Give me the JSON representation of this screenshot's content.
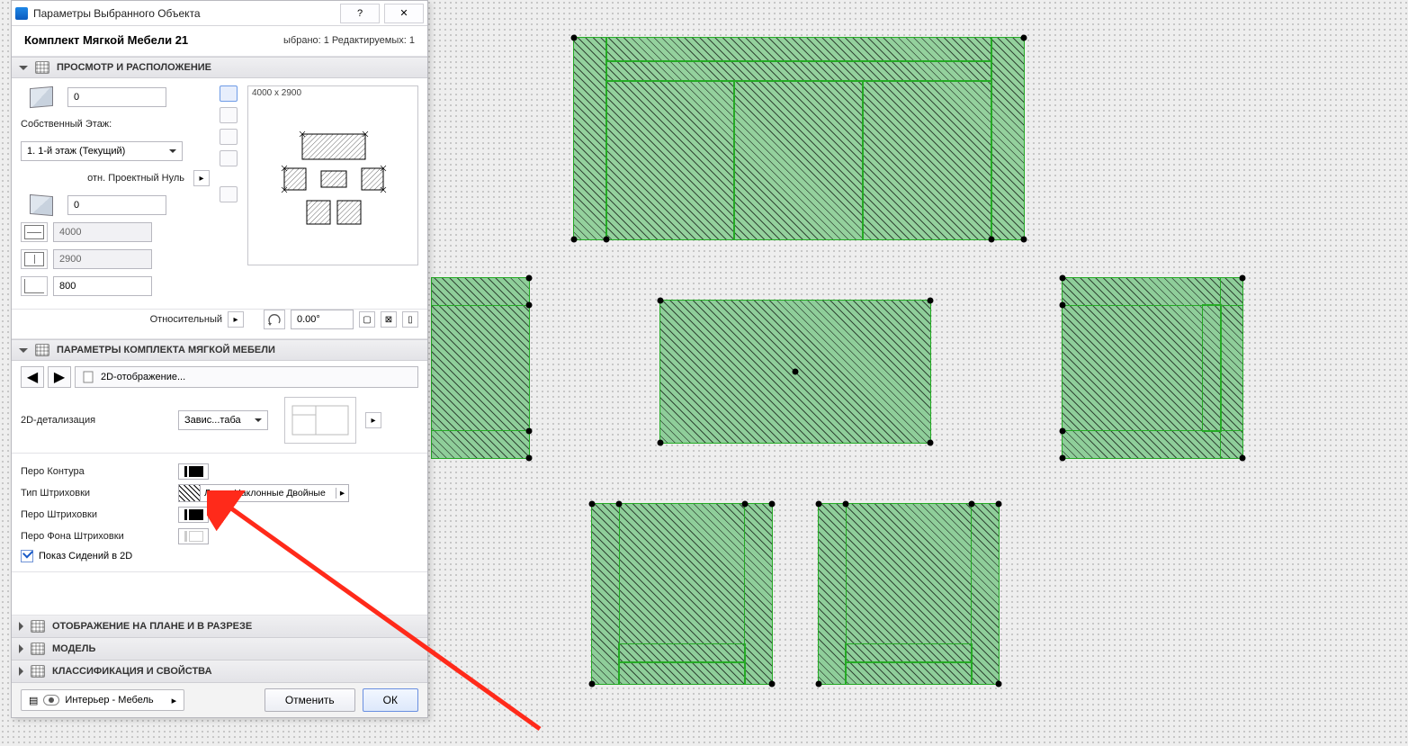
{
  "dialog": {
    "title": "Параметры Выбранного Объекта",
    "object_name": "Комплект Мягкой Мебели 21",
    "selection_info": "ыбрано: 1 Редактируемых: 1"
  },
  "head": {
    "preview": "ПРОСМОТР И РАСПОЛОЖЕНИЕ",
    "params": "ПАРАМЕТРЫ КОМПЛЕКТА МЯГКОЙ МЕБЕЛИ",
    "plan": "ОТОБРАЖЕНИЕ НА ПЛАНЕ И В РАЗРЕЗЕ",
    "model": "МОДЕЛЬ",
    "classif": "КЛАССИФИКАЦИЯ И СВОЙСТВА"
  },
  "placement": {
    "z_top": "0",
    "own_story_label": "Собственный Этаж:",
    "own_story_value": "1. 1-й этаж (Текущий)",
    "proj_zero_label": "отн. Проектный Нуль",
    "z_bottom": "0",
    "dim_x": "4000",
    "dim_y": "2900",
    "dim_z": "800",
    "preview_dim": "4000 x 2900",
    "rot_label": "Относительный",
    "rot_value": "0.00°"
  },
  "nav": {
    "crumb": "2D-отображение...",
    "detail_label": "2D-детализация",
    "detail_value": "Завис...таба"
  },
  "params": {
    "contour_pen": "Перо Контура",
    "hatch_type": "Тип Штриховки",
    "hatch_type_value": "Линии Наклонные Двойные",
    "hatch_pen": "Перо Штриховки",
    "hatch_bg_pen": "Перо Фона Штриховки",
    "show_seats": "Показ Сидений в 2D"
  },
  "footer": {
    "layer": "Интерьер - Мебель",
    "cancel": "Отменить",
    "ok": "ОК"
  }
}
